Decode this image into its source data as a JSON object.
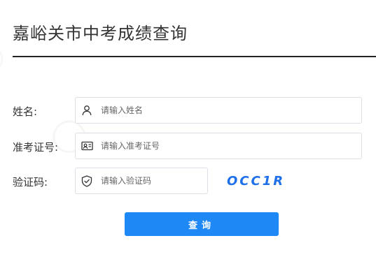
{
  "page": {
    "title": "嘉峪关市中考成绩查询"
  },
  "form": {
    "name": {
      "label": "姓名:",
      "placeholder": "请输入姓名",
      "icon": "user-icon"
    },
    "exam_id": {
      "label": "准考证号:",
      "placeholder": "请输入准考证号",
      "icon": "id-card-icon"
    },
    "captcha": {
      "label": "验证码:",
      "placeholder": "请输入验证码",
      "icon": "shield-check-icon",
      "code": "OCC1R"
    },
    "submit_label": "查询"
  },
  "colors": {
    "accent": "#1e88f5",
    "captcha": "#1f6fe8",
    "divider": "#222222",
    "border": "#dcdfe6"
  }
}
